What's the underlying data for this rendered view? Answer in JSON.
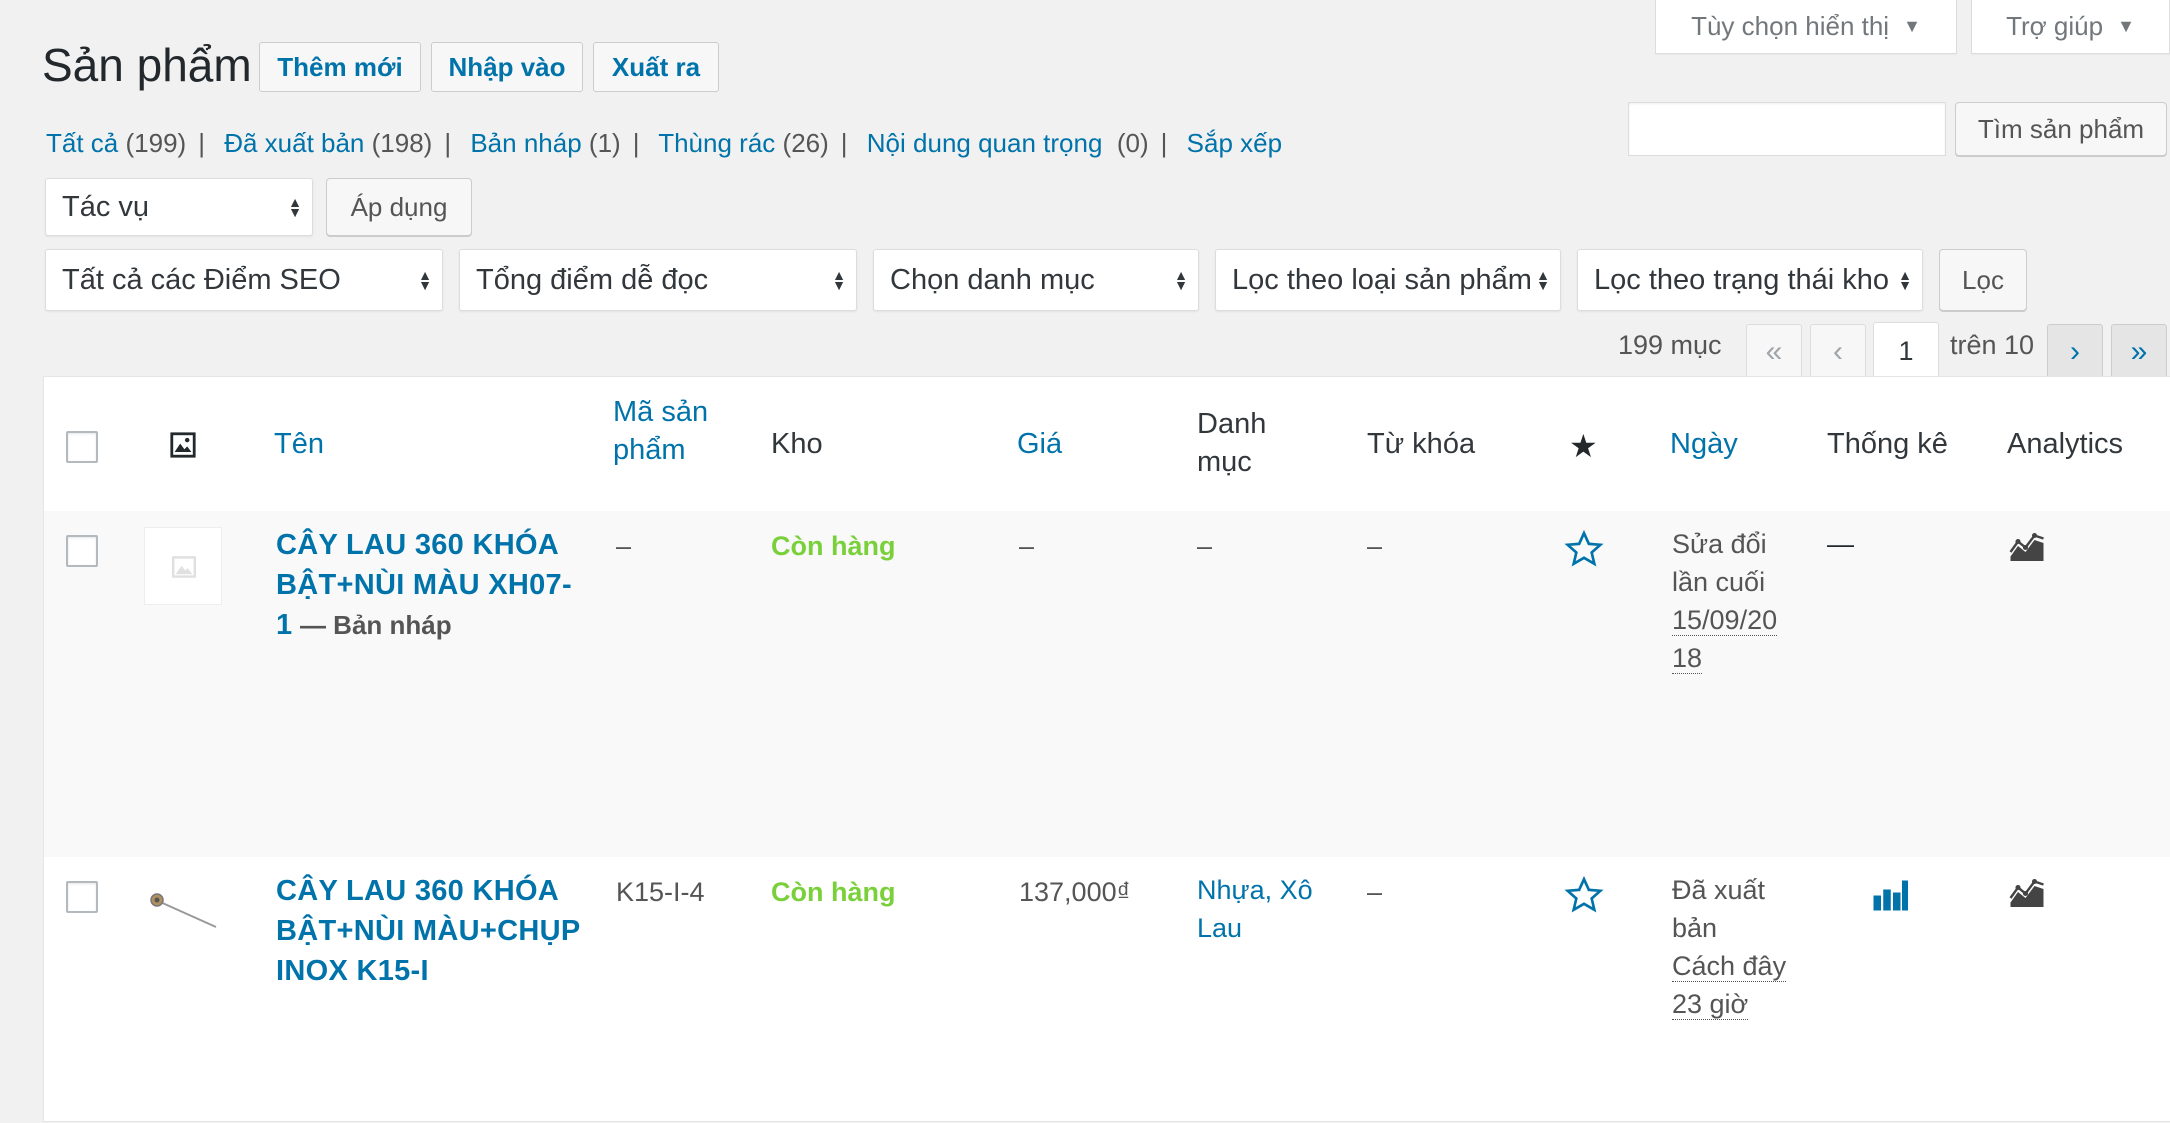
{
  "screen_meta": {
    "options_label": "Tùy chọn hiển thị",
    "help_label": "Trợ giúp"
  },
  "header": {
    "title": "Sản phẩm",
    "add_new": "Thêm mới",
    "import": "Nhập vào",
    "export": "Xuất ra"
  },
  "views": [
    {
      "label": "Tất cả",
      "count": "(199)"
    },
    {
      "label": "Đã xuất bản",
      "count": "(198)"
    },
    {
      "label": "Bản nháp",
      "count": "(1)"
    },
    {
      "label": "Thùng rác",
      "count": "(26)"
    },
    {
      "label": "Nội dung quan trọng",
      "count": "(0)"
    },
    {
      "label": "Sắp xếp",
      "count": ""
    }
  ],
  "search": {
    "value": "",
    "button": "Tìm sản phẩm"
  },
  "bulk": {
    "action": "Tác vụ",
    "apply": "Áp dụng"
  },
  "filters": {
    "seo": "Tất cả các Điểm SEO",
    "readability": "Tổng điểm dễ đọc",
    "category": "Chọn danh mục",
    "product_type": "Lọc theo loại sản phẩm",
    "stock_status": "Lọc theo trạng thái kho",
    "filter_button": "Lọc"
  },
  "pagination": {
    "items": "199 mục",
    "first": "«",
    "prev": "‹",
    "current": "1",
    "of": "trên 10",
    "next": "›",
    "last": "»"
  },
  "columns": {
    "name": "Tên",
    "sku_line1": "Mã sản",
    "sku_line2": "phẩm",
    "stock": "Kho",
    "price": "Giá",
    "category_line1": "Danh",
    "category_line2": "mục",
    "tags": "Từ khóa",
    "date": "Ngày",
    "stats": "Thống kê",
    "analytics": "Analytics"
  },
  "rows": [
    {
      "name_line1": "CÂY LAU 360 KHÓA",
      "name_line2": "BẬT+NÙI MÀU XH07-",
      "name_line3": "1",
      "draft": "— Bản nháp",
      "sku": "–",
      "stock": "Còn hàng",
      "price": "–",
      "category": "–",
      "tags": "–",
      "stats": "—",
      "date_line1": "Sửa đổi",
      "date_line2": "lần cuối",
      "date_line3": "15/09/20",
      "date_line4": "18"
    },
    {
      "name_line1": "CÂY LAU 360 KHÓA",
      "name_line2": "BẬT+NÙI MÀU+CHỤP",
      "name_line3": "INOX K15-I",
      "sku": "K15-I-4",
      "stock": "Còn hàng",
      "price": "137,000₫",
      "category_line1": "Nhựa, Xô",
      "category_line2": "Lau",
      "tags": "–",
      "date_line1": "Đã xuất",
      "date_line2": "bản",
      "date_line3": "Cách đây",
      "date_line4": "23 giờ"
    }
  ],
  "colors": {
    "link": "#0073aa",
    "instock": "#7ad03a",
    "background": "#f1f1f1"
  }
}
